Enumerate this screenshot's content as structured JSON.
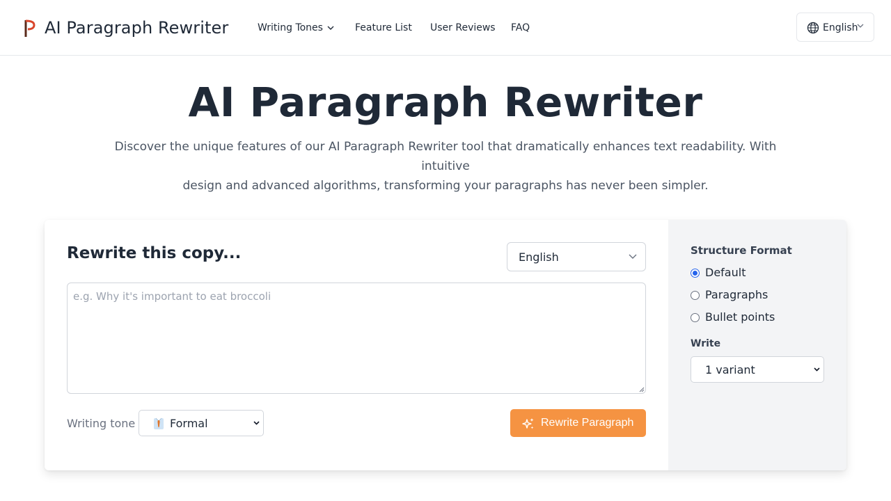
{
  "header": {
    "logo_text": "AI Paragraph Rewriter",
    "nav": [
      {
        "label": "Writing Tones",
        "has_dropdown": true
      },
      {
        "label": "Feature List"
      },
      {
        "label": "User Reviews"
      },
      {
        "label": "FAQ"
      }
    ],
    "language_label": "English"
  },
  "hero": {
    "title": "AI Paragraph Rewriter",
    "subtitle_line1": "Discover the unique features of our AI Paragraph Rewriter tool that dramatically enhances text readability. With intuitive",
    "subtitle_line2": "design and advanced algorithms, transforming your paragraphs has never been simpler."
  },
  "form": {
    "title": "Rewrite this copy...",
    "language_value": "English",
    "input_placeholder": "e.g. Why it's important to eat broccoli",
    "input_value": "",
    "tone_label": "Writing tone",
    "tone_value": "Formal",
    "tone_icon": "necktie-emoji",
    "submit_label": "Rewrite Paragraph",
    "submit_color": "#f59342"
  },
  "options": {
    "structure_title": "Structure Format",
    "structure_options": [
      {
        "label": "Default",
        "checked": true
      },
      {
        "label": "Paragraphs",
        "checked": false
      },
      {
        "label": "Bullet points",
        "checked": false
      }
    ],
    "write_label": "Write",
    "variant_value": "1 variant"
  }
}
